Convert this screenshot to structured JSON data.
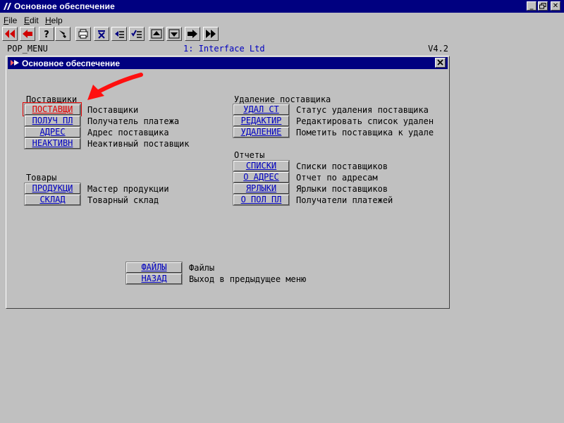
{
  "window": {
    "title": "Основное обеспечение",
    "controls": [
      "minimize-icon",
      "restore-icon",
      "close-icon"
    ]
  },
  "menubar": [
    {
      "label": "File",
      "accel": "F"
    },
    {
      "label": "Edit",
      "accel": "E"
    },
    {
      "label": "Help",
      "accel": "H"
    }
  ],
  "toolbar": {
    "buttons": [
      {
        "icon": "double-left-arrow-icon"
      },
      {
        "icon": "left-arrow-icon"
      },
      {
        "icon": "question-icon"
      },
      {
        "icon": "pointer-icon"
      },
      {
        "icon": "printer-icon"
      },
      {
        "icon": "delete-icon"
      },
      {
        "icon": "insert-icon"
      },
      {
        "icon": "checklist-icon"
      },
      {
        "icon": "move-up-icon"
      },
      {
        "icon": "move-down-icon"
      },
      {
        "icon": "right-arrow-icon"
      },
      {
        "icon": "double-right-arrow-icon"
      }
    ]
  },
  "status": {
    "menu_id": "POP_MENU",
    "company": "1: Interface Ltd",
    "version": "V4.2"
  },
  "inner_window": {
    "title": "Основное обеспечение"
  },
  "sections": {
    "suppliers": {
      "heading": "Поставщики",
      "items": [
        {
          "button": "ПОСТАВЩИ",
          "desc": "Поставщики"
        },
        {
          "button": "ПОЛУЧ ПЛ",
          "desc": "Получатель платежа"
        },
        {
          "button": "АДРЕС",
          "desc": "Адрес поставщика"
        },
        {
          "button": "НЕАКТИВН",
          "desc": "Неактивный поставщик"
        }
      ]
    },
    "goods": {
      "heading": "Товары",
      "items": [
        {
          "button": "ПРОДУКЦИ",
          "desc": "Мастер продукции"
        },
        {
          "button": "СКЛАД",
          "desc": "Товарный склад"
        }
      ]
    },
    "deletion": {
      "heading": "Удаление поставщика",
      "items": [
        {
          "button": "УДАЛ СТ",
          "desc": "Статус удаления поставщика"
        },
        {
          "button": "РЕДАКТИР",
          "desc": "Редактировать список удален"
        },
        {
          "button": "УДАЛЕНИЕ",
          "desc": "Пометить поставщика к удале"
        }
      ]
    },
    "reports": {
      "heading": "Отчеты",
      "items": [
        {
          "button": "СПИСКИ",
          "desc": "Списки поставщиков"
        },
        {
          "button": "О АДРЕС",
          "desc": "Отчет по адресам"
        },
        {
          "button": "ЯРЛЫКИ",
          "desc": "Ярлыки поставщиков"
        },
        {
          "button": "О ПОЛ ПЛ",
          "desc": "Получатели платежей"
        }
      ]
    },
    "bottom": {
      "items": [
        {
          "button": "ФАЙЛЫ",
          "desc": "Файлы"
        },
        {
          "button": "НАЗАД",
          "desc": "Выход в предыдущее меню"
        }
      ]
    }
  },
  "colors": {
    "titlebar": "#000080",
    "link": "#0000c0",
    "selected": "#e00000",
    "background": "#c0c0c0"
  }
}
